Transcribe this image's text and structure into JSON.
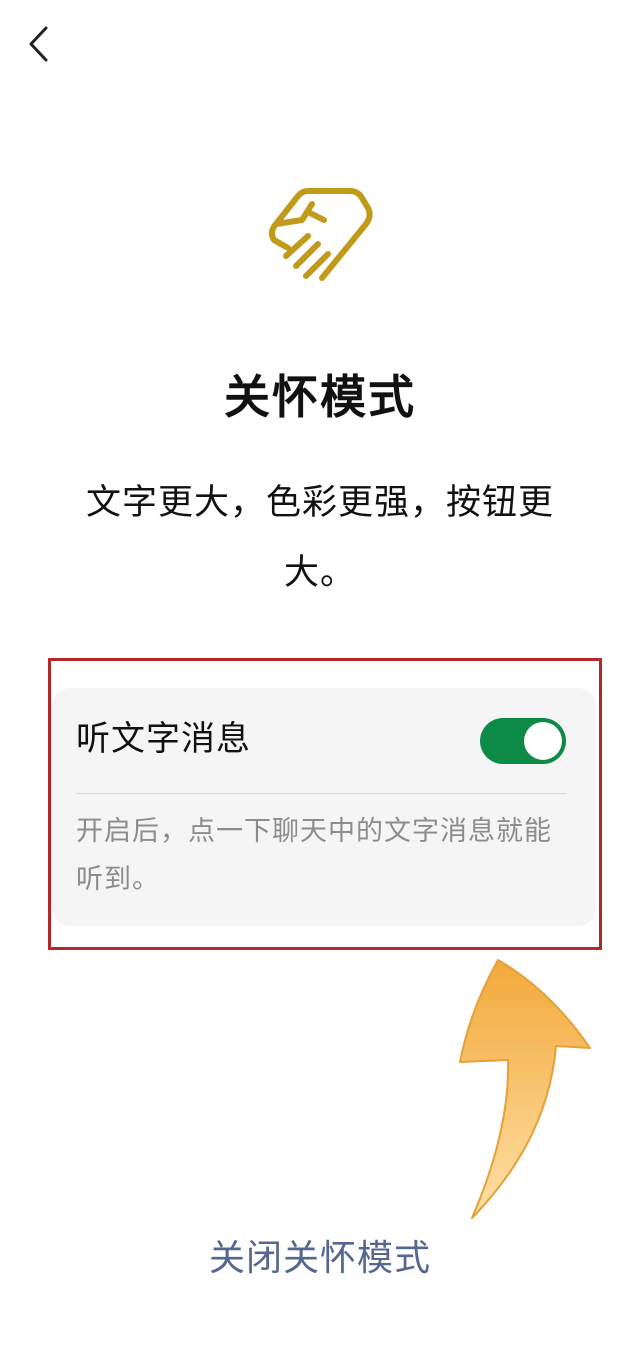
{
  "header": {
    "back_icon": "chevron-left-icon"
  },
  "logo": {
    "icon": "heart-hand-icon",
    "color": "#c29a1a"
  },
  "page": {
    "title": "关怀模式",
    "subtitle": "文字更大，色彩更强，按钮更大。"
  },
  "card": {
    "label": "听文字消息",
    "toggle_on": true,
    "toggle_color": "#0e8a47",
    "description": "开启后，点一下聊天中的文字消息就能听到。"
  },
  "annotation": {
    "frame_color": "#b3262a",
    "arrow_color": "#f5b942"
  },
  "footer": {
    "close_label": "关闭关怀模式",
    "link_color": "#55678f"
  }
}
